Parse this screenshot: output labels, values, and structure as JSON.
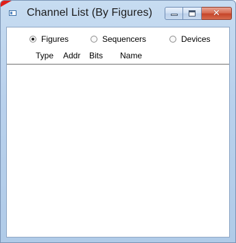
{
  "window": {
    "title": "Channel List (By Figures)",
    "buttons": {
      "minimize": "minimize-icon",
      "maximize": "maximize-icon",
      "close": "close-icon"
    },
    "colors": {
      "frame": "#b9d1ec",
      "close_button": "#c5452a"
    }
  },
  "view_mode": {
    "options": [
      {
        "label": "Figures",
        "checked": true
      },
      {
        "label": "Sequencers",
        "checked": false
      },
      {
        "label": "Devices",
        "checked": false
      }
    ]
  },
  "list": {
    "columns": [
      "Type",
      "Addr",
      "Bits",
      "Name"
    ],
    "rows": []
  }
}
